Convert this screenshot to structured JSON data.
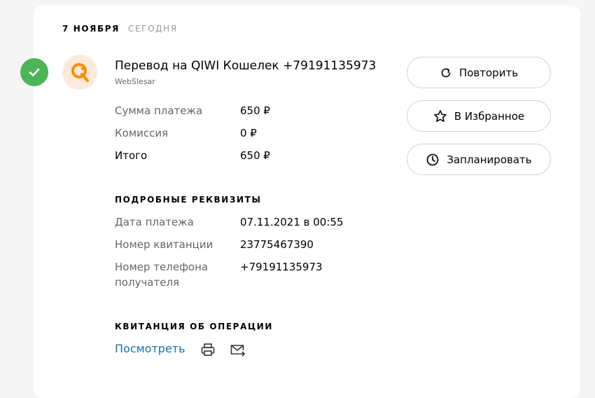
{
  "date": {
    "day": "7 НОЯБРЯ",
    "relative": "СЕГОДНЯ"
  },
  "payment": {
    "title": "Перевод на QIWI Кошелек +79191135973",
    "subtitle": "WebSlesar",
    "status_icon": "check-icon",
    "provider_icon": "qiwi-logo-icon"
  },
  "amounts": [
    {
      "label": "Сумма платежа",
      "value": "650 ₽"
    },
    {
      "label": "Комиссия",
      "value": "0 ₽"
    },
    {
      "label": "Итого",
      "value": "650 ₽"
    }
  ],
  "details": {
    "heading": "ПОДРОБНЫЕ РЕКВИЗИТЫ",
    "rows": [
      {
        "label": "Дата платежа",
        "value": "07.11.2021 в 00:55"
      },
      {
        "label": "Номер квитанции",
        "value": "23775467390"
      },
      {
        "label": "Номер телефона получателя",
        "value": "+79191135973"
      }
    ]
  },
  "receipt": {
    "heading": "КВИТАНЦИЯ ОБ ОПЕРАЦИИ",
    "view_label": "Посмотреть",
    "print_icon": "printer-icon",
    "email_icon": "mail-send-icon"
  },
  "actions": {
    "repeat": "Повторить",
    "favorite": "В Избранное",
    "schedule": "Запланировать"
  },
  "colors": {
    "success": "#4cb557",
    "qiwi_orange": "#ff8c00",
    "link": "#1a6fb5"
  }
}
